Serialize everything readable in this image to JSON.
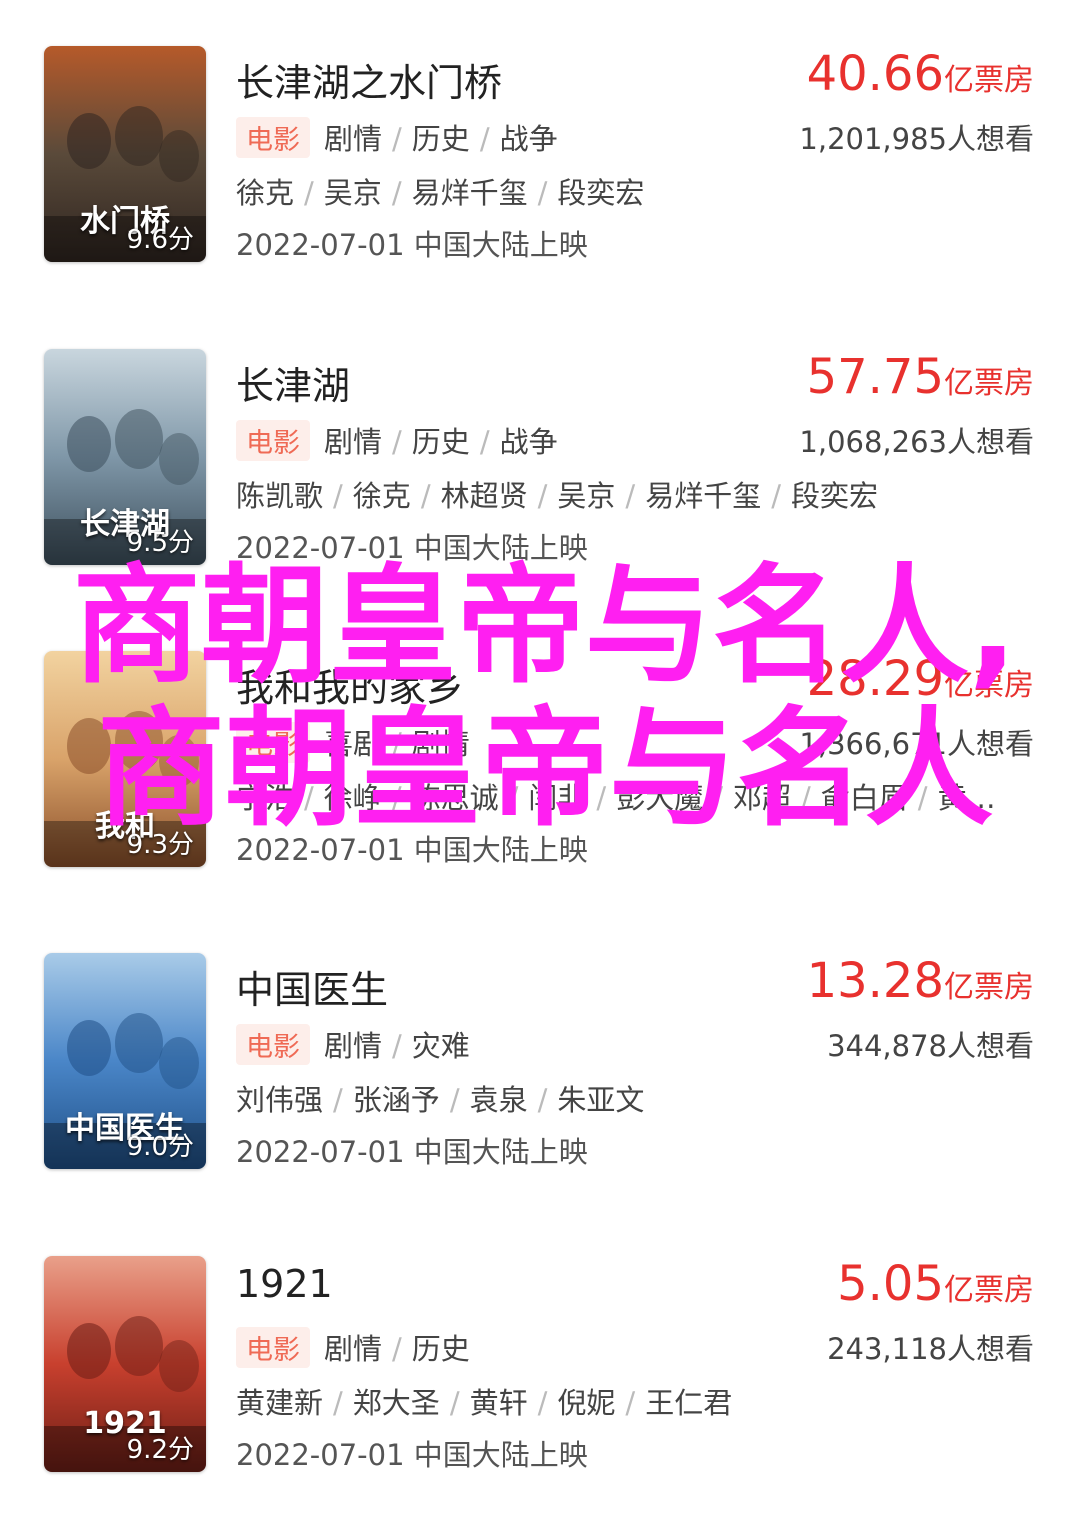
{
  "movies": [
    {
      "title": "长津湖之水门桥",
      "score": "9.6分",
      "box_number": "40.66",
      "box_unit": "亿票房",
      "tag": "电影",
      "genres": [
        "剧情",
        "历史",
        "战争"
      ],
      "want": "1,201,985人想看",
      "cast": [
        "徐克",
        "吴京",
        "易烊千玺",
        "段奕宏"
      ],
      "release": "2022-07-01 中国大陆上映",
      "poster_text": "水门桥",
      "poster_colors": [
        "#5a4a3a",
        "#2f2520",
        "#b65a2a"
      ]
    },
    {
      "title": "长津湖",
      "score": "9.5分",
      "box_number": "57.75",
      "box_unit": "亿票房",
      "tag": "电影",
      "genres": [
        "剧情",
        "历史",
        "战争"
      ],
      "want": "1,068,263人想看",
      "cast": [
        "陈凯歌",
        "徐克",
        "林超贤",
        "吴京",
        "易烊千玺",
        "段奕宏"
      ],
      "release": "2022-07-01 中国大陆上映",
      "poster_text": "长津湖",
      "poster_colors": [
        "#7f97a8",
        "#3d4f5c",
        "#c9d6de"
      ]
    },
    {
      "title": "我和我的家乡",
      "score": "9.3分",
      "box_number": "28.29",
      "box_unit": "亿票房",
      "tag": "电影",
      "genres": [
        "喜剧",
        "剧情"
      ],
      "want": "1,366,671人想看",
      "cast": [
        "宁浩",
        "徐峥",
        "陈思诚",
        "闫非",
        "彭大魔",
        "邓超",
        "俞白眉",
        "黄…"
      ],
      "release": "2022-07-01 中国大陆上映",
      "poster_text": "我和",
      "poster_colors": [
        "#d9a36a",
        "#8a4f2a",
        "#f2d3a0"
      ]
    },
    {
      "title": "中国医生",
      "score": "9.0分",
      "box_number": "13.28",
      "box_unit": "亿票房",
      "tag": "电影",
      "genres": [
        "剧情",
        "灾难"
      ],
      "want": "344,878人想看",
      "cast": [
        "刘伟强",
        "张涵予",
        "袁泉",
        "朱亚文"
      ],
      "release": "2022-07-01 中国大陆上映",
      "poster_text": "中国医生",
      "poster_colors": [
        "#4a86c8",
        "#1f4f86",
        "#a9cbe8"
      ]
    },
    {
      "title": "1921",
      "score": "9.2分",
      "box_number": "5.05",
      "box_unit": "亿票房",
      "tag": "电影",
      "genres": [
        "剧情",
        "历史"
      ],
      "want": "243,118人想看",
      "cast": [
        "黄建新",
        "郑大圣",
        "黄轩",
        "倪妮",
        "王仁君"
      ],
      "release": "2022-07-01 中国大陆上映",
      "poster_text": "1921",
      "poster_colors": [
        "#c8402e",
        "#6b1e16",
        "#e9a08a"
      ]
    }
  ],
  "overlay_text": "商朝皇帝与名人,商朝皇帝与名人",
  "colors": {
    "box_office": "#e8312e",
    "tag_bg": "#fdeeea",
    "tag_text": "#ef6a55",
    "overlay": "#ff1ff1"
  }
}
